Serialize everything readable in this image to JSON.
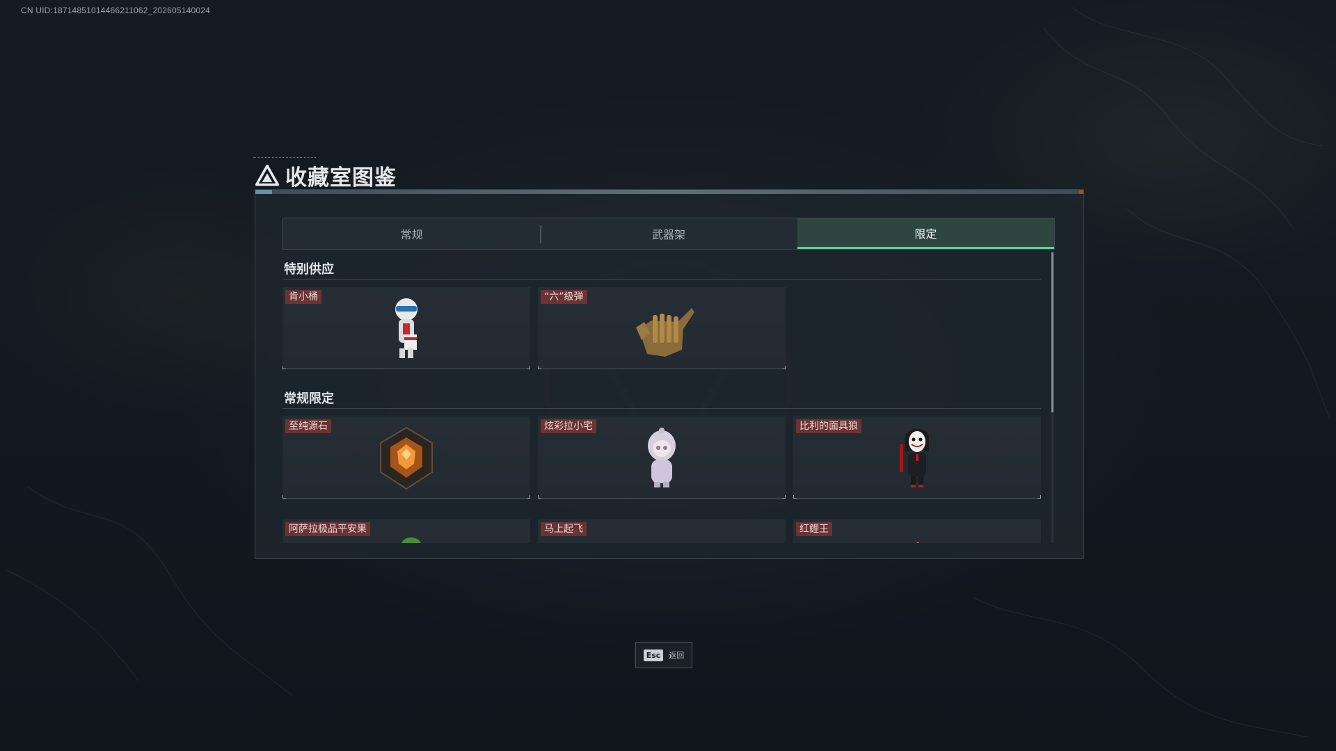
{
  "uid": "CN UID:18714851014466211062_202605140024",
  "title": "收藏室图鉴",
  "tabs": [
    {
      "label": "常规",
      "active": false
    },
    {
      "label": "武器架",
      "active": false
    },
    {
      "label": "限定",
      "active": true
    }
  ],
  "sections": [
    {
      "title": "特别供应",
      "items": [
        {
          "label": "肯小桶",
          "icon": "mascot-figure-icon"
        },
        {
          "label": "“六”级弹",
          "icon": "bullet-hand-icon"
        }
      ]
    },
    {
      "title": "常规限定",
      "items": [
        {
          "label": "至纯源石",
          "icon": "crystal-gem-icon"
        },
        {
          "label": "炫彩拉小宅",
          "icon": "hooded-figure-icon"
        },
        {
          "label": "比利的面具狼",
          "icon": "masked-puppet-icon"
        }
      ]
    },
    {
      "title": "",
      "items": [
        {
          "label": "阿萨拉极品平安果",
          "icon": "apple-icon"
        },
        {
          "label": "马上起飞",
          "icon": "horse-icon"
        },
        {
          "label": "红鲤王",
          "icon": "koi-fish-icon"
        }
      ]
    }
  ],
  "footer": {
    "esc_key": "Esc",
    "esc_label": "返回"
  },
  "colors": {
    "accent": "#5ed49a",
    "tag_bg": "#6a3334"
  }
}
